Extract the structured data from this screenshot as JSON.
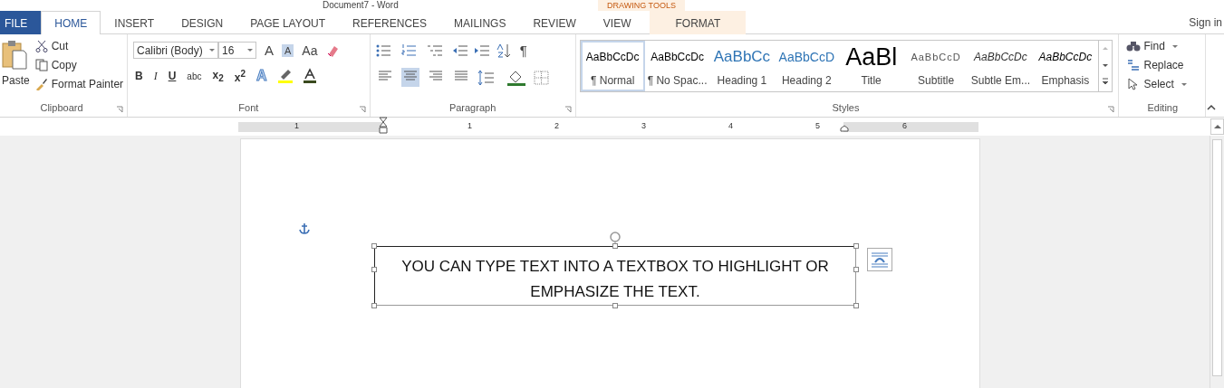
{
  "window": {
    "title": "Document7 - Word",
    "context_group": "DRAWING TOOLS",
    "sign_in": "Sign in"
  },
  "tabs": [
    {
      "label": "FILE",
      "kind": "file",
      "selected": false
    },
    {
      "label": "HOME",
      "kind": "normal",
      "selected": true
    },
    {
      "label": "INSERT",
      "kind": "normal",
      "selected": false
    },
    {
      "label": "DESIGN",
      "kind": "normal",
      "selected": false
    },
    {
      "label": "PAGE LAYOUT",
      "kind": "normal",
      "selected": false
    },
    {
      "label": "REFERENCES",
      "kind": "normal",
      "selected": false
    },
    {
      "label": "MAILINGS",
      "kind": "normal",
      "selected": false
    },
    {
      "label": "REVIEW",
      "kind": "normal",
      "selected": false
    },
    {
      "label": "VIEW",
      "kind": "normal",
      "selected": false
    },
    {
      "label": "FORMAT",
      "kind": "contextual",
      "selected": false
    }
  ],
  "clipboard": {
    "paste": "Paste",
    "cut": "Cut",
    "copy": "Copy",
    "format_painter": "Format Painter",
    "label": "Clipboard"
  },
  "font": {
    "name": "Calibri (Body)",
    "size": "16",
    "grow": {
      "label": "A",
      "selected": false
    },
    "shrink": {
      "label": "A",
      "selected": true
    },
    "case": "Aa",
    "text_effects": "A",
    "format_buttons": [
      {
        "label": "B",
        "kind": "bold"
      },
      {
        "label": "I",
        "kind": "italic"
      },
      {
        "label": "U",
        "kind": "underline"
      },
      {
        "label": "abc",
        "kind": "strike"
      },
      {
        "label": "x$_{2}$",
        "kind": "plain"
      },
      {
        "label": "x$^{2}$",
        "kind": "plain"
      }
    ],
    "label": "Font"
  },
  "paragraph": {
    "show_marks": "¶",
    "align": [
      {
        "selected": false
      },
      {
        "selected": true
      },
      {
        "selected": false
      },
      {
        "selected": false
      }
    ],
    "label": "Paragraph"
  },
  "styles": {
    "items": [
      {
        "preview": "AaBbCcDc",
        "name": "¶ Normal",
        "kind": "normal",
        "selected": true
      },
      {
        "preview": "AaBbCcDc",
        "name": "¶ No Spac...",
        "kind": "normal",
        "selected": false
      },
      {
        "preview": "AaBbCc",
        "name": "Heading 1",
        "kind": "heading1",
        "selected": false
      },
      {
        "preview": "AaBbCcD",
        "name": "Heading 2",
        "kind": "heading2",
        "selected": false
      },
      {
        "preview": "AaBl",
        "name": "Title",
        "kind": "title",
        "selected": false
      },
      {
        "preview": "AaBbCcD",
        "name": "Subtitle",
        "kind": "subtitle",
        "selected": false
      },
      {
        "preview": "AaBbCcDc",
        "name": "Subtle Em...",
        "kind": "subtle",
        "selected": false
      },
      {
        "preview": "AaBbCcDc",
        "name": "Emphasis",
        "kind": "emphasis",
        "selected": false
      }
    ],
    "label": "Styles"
  },
  "editing": {
    "find": "Find",
    "replace": "Replace",
    "select": "Select",
    "label": "Editing"
  },
  "ruler": [
    "1",
    "1",
    "2",
    "3",
    "4",
    "5",
    "6"
  ],
  "textbox": {
    "text": "YOU CAN TYPE TEXT INTO A TEXTBOX TO HIGHLIGHT OR EMPHASIZE THE TEXT."
  }
}
